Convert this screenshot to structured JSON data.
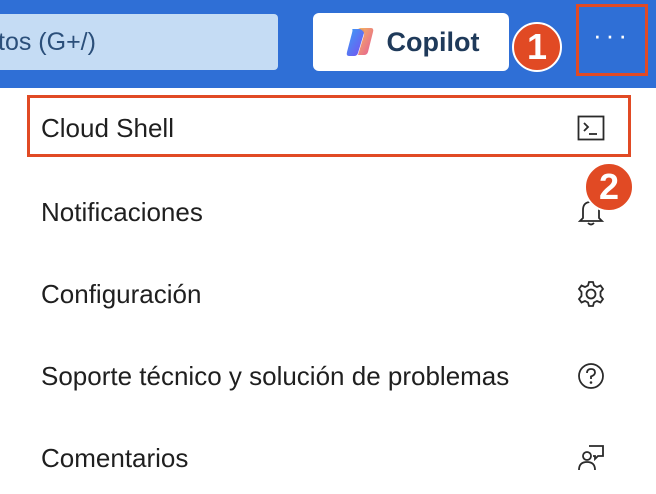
{
  "header": {
    "search_text": "tos (G+/)",
    "copilot_label": "Copilot",
    "more_label": "···"
  },
  "annotations": {
    "step1": "1",
    "step2": "2"
  },
  "menu": {
    "items": [
      {
        "label": "Cloud Shell",
        "icon": "terminal-icon"
      },
      {
        "label": "Notificaciones",
        "icon": "bell-icon"
      },
      {
        "label": "Configuración",
        "icon": "gear-icon"
      },
      {
        "label": "Soporte técnico y solución de problemas",
        "icon": "question-icon"
      },
      {
        "label": "Comentarios",
        "icon": "feedback-icon"
      }
    ]
  },
  "colors": {
    "header_bg": "#2f6fd6",
    "highlight": "#e14a24",
    "search_bg": "#c5dcf4"
  }
}
